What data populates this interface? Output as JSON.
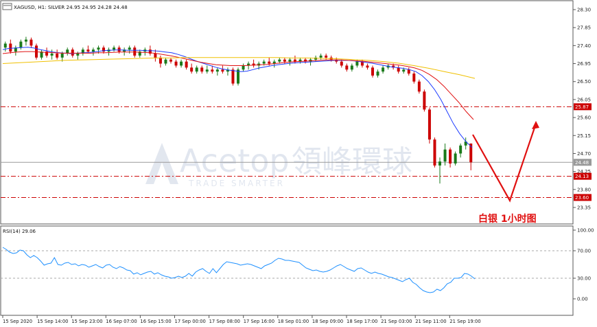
{
  "header": {
    "symbol_line": "XAGUSD, H1:  SILVER  24.95 24.95 24.28 24.48"
  },
  "annotation": {
    "text": "白银  1小时图"
  },
  "watermark": {
    "brand": "Acetop",
    "chinese": "領峰環球",
    "tagline": "TRADE SMARTER"
  },
  "colors": {
    "bull": "#1a7a1a",
    "bear": "#cc0000",
    "ma_fast": "#1e3cff",
    "ma_mid": "#e01010",
    "ma_slow": "#f0c000",
    "level_line": "#cc0000",
    "rsi_line": "#1e90ff",
    "arrow": "#e01010"
  },
  "chart_data": [
    {
      "type": "candlestick",
      "name": "XAGUSD H1",
      "yticks": [
        "28.30",
        "27.85",
        "27.40",
        "26.95",
        "26.50",
        "26.05",
        "25.60",
        "25.15",
        "24.70",
        "24.25",
        "23.80",
        "23.35"
      ],
      "ylim": [
        23.05,
        28.38
      ],
      "xticks": [
        "15 Sep 2020",
        "15 Sep 14:00",
        "15 Sep 23:00",
        "16 Sep 07:00",
        "16 Sep 15:00",
        "17 Sep 00:00",
        "17 Sep 08:00",
        "17 Sep 16:00",
        "18 Sep 01:00",
        "18 Sep 09:00",
        "18 Sep 17:00",
        "21 Sep 03:00",
        "21 Sep 11:00",
        "21 Sep 19:00"
      ],
      "price_tags": [
        {
          "label": "25.87",
          "value": 25.87,
          "style": "dash-dot",
          "color": "#cc0000"
        },
        {
          "label": "24.48",
          "value": 24.48,
          "style": "solid-light",
          "color": "#999999"
        },
        {
          "label": "24.13",
          "value": 24.13,
          "style": "dash-dot",
          "color": "#cc0000"
        },
        {
          "label": "23.60",
          "value": 23.6,
          "style": "dash-dot",
          "color": "#cc0000"
        }
      ],
      "candles": [
        [
          27.35,
          27.5,
          27.25,
          27.45
        ],
        [
          27.45,
          27.55,
          27.2,
          27.25
        ],
        [
          27.25,
          27.4,
          27.15,
          27.35
        ],
        [
          27.35,
          27.55,
          27.3,
          27.5
        ],
        [
          27.5,
          27.62,
          27.4,
          27.55
        ],
        [
          27.55,
          27.6,
          27.35,
          27.4
        ],
        [
          27.4,
          27.45,
          27.05,
          27.1
        ],
        [
          27.1,
          27.3,
          27.05,
          27.25
        ],
        [
          27.25,
          27.35,
          27.1,
          27.15
        ],
        [
          27.15,
          27.3,
          27.05,
          27.2
        ],
        [
          27.2,
          27.3,
          27.05,
          27.1
        ],
        [
          27.1,
          27.25,
          27.0,
          27.2
        ],
        [
          27.2,
          27.35,
          27.15,
          27.3
        ],
        [
          27.3,
          27.35,
          27.1,
          27.15
        ],
        [
          27.15,
          27.25,
          27.05,
          27.2
        ],
        [
          27.2,
          27.35,
          27.15,
          27.3
        ],
        [
          27.3,
          27.4,
          27.2,
          27.25
        ],
        [
          27.25,
          27.35,
          27.15,
          27.3
        ],
        [
          27.3,
          27.4,
          27.2,
          27.35
        ],
        [
          27.35,
          27.4,
          27.2,
          27.25
        ],
        [
          27.25,
          27.35,
          27.15,
          27.3
        ],
        [
          27.3,
          27.4,
          27.25,
          27.35
        ],
        [
          27.35,
          27.4,
          27.2,
          27.25
        ],
        [
          27.25,
          27.35,
          27.15,
          27.3
        ],
        [
          27.3,
          27.4,
          27.2,
          27.35
        ],
        [
          27.35,
          27.4,
          27.1,
          27.15
        ],
        [
          27.15,
          27.3,
          27.1,
          27.25
        ],
        [
          27.25,
          27.35,
          27.15,
          27.3
        ],
        [
          27.3,
          27.4,
          27.15,
          27.2
        ],
        [
          27.2,
          27.3,
          27.0,
          27.1
        ],
        [
          27.1,
          27.15,
          26.85,
          26.95
        ],
        [
          26.95,
          27.1,
          26.9,
          27.05
        ],
        [
          27.05,
          27.1,
          26.95,
          27.0
        ],
        [
          27.0,
          27.05,
          26.85,
          26.9
        ],
        [
          26.9,
          27.05,
          26.85,
          27.0
        ],
        [
          27.0,
          27.05,
          26.8,
          26.85
        ],
        [
          26.85,
          26.95,
          26.7,
          26.75
        ],
        [
          26.75,
          26.9,
          26.7,
          26.85
        ],
        [
          26.85,
          26.9,
          26.7,
          26.75
        ],
        [
          26.75,
          26.9,
          26.7,
          26.8
        ],
        [
          26.8,
          26.9,
          26.7,
          26.75
        ],
        [
          26.75,
          26.85,
          26.65,
          26.8
        ],
        [
          26.8,
          26.9,
          26.7,
          26.75
        ],
        [
          26.75,
          26.85,
          26.65,
          26.8
        ],
        [
          26.8,
          26.85,
          26.4,
          26.45
        ],
        [
          26.45,
          26.85,
          26.4,
          26.8
        ],
        [
          26.8,
          26.95,
          26.75,
          26.9
        ],
        [
          26.9,
          27.0,
          26.8,
          26.95
        ],
        [
          26.95,
          27.05,
          26.85,
          26.9
        ],
        [
          26.9,
          27.0,
          26.8,
          26.95
        ],
        [
          26.95,
          27.05,
          26.9,
          27.0
        ],
        [
          27.0,
          27.1,
          26.9,
          26.95
        ],
        [
          26.95,
          27.05,
          26.85,
          27.0
        ],
        [
          27.0,
          27.1,
          26.95,
          27.05
        ],
        [
          27.05,
          27.1,
          26.95,
          27.0
        ],
        [
          27.0,
          27.1,
          26.9,
          27.05
        ],
        [
          27.05,
          27.15,
          26.95,
          27.0
        ],
        [
          27.0,
          27.1,
          26.95,
          27.05
        ],
        [
          27.05,
          27.1,
          26.95,
          27.0
        ],
        [
          27.0,
          27.1,
          26.9,
          27.05
        ],
        [
          27.05,
          27.15,
          27.0,
          27.1
        ],
        [
          27.1,
          27.2,
          27.05,
          27.15
        ],
        [
          27.15,
          27.2,
          27.05,
          27.1
        ],
        [
          27.1,
          27.15,
          27.0,
          27.05
        ],
        [
          27.05,
          27.1,
          26.95,
          27.0
        ],
        [
          27.0,
          27.05,
          26.85,
          26.9
        ],
        [
          26.9,
          26.95,
          26.75,
          26.8
        ],
        [
          26.8,
          26.95,
          26.75,
          26.9
        ],
        [
          26.9,
          27.05,
          26.85,
          27.0
        ],
        [
          27.0,
          27.05,
          26.85,
          26.9
        ],
        [
          26.9,
          26.95,
          26.8,
          26.85
        ],
        [
          26.85,
          26.9,
          26.6,
          26.65
        ],
        [
          26.65,
          26.8,
          26.6,
          26.75
        ],
        [
          26.75,
          26.9,
          26.7,
          26.85
        ],
        [
          26.85,
          26.95,
          26.8,
          26.9
        ],
        [
          26.9,
          26.95,
          26.8,
          26.85
        ],
        [
          26.85,
          26.9,
          26.7,
          26.75
        ],
        [
          26.75,
          26.85,
          26.7,
          26.8
        ],
        [
          26.8,
          26.85,
          26.65,
          26.7
        ],
        [
          26.7,
          26.75,
          26.45,
          26.5
        ],
        [
          26.5,
          26.55,
          26.2,
          26.25
        ],
        [
          26.25,
          26.3,
          25.75,
          25.8
        ],
        [
          25.8,
          25.85,
          24.95,
          25.05
        ],
        [
          25.05,
          25.1,
          24.35,
          24.4
        ],
        [
          24.4,
          24.6,
          23.95,
          24.5
        ],
        [
          24.5,
          24.95,
          24.4,
          24.8
        ],
        [
          24.8,
          24.85,
          24.35,
          24.45
        ],
        [
          24.45,
          24.75,
          24.4,
          24.7
        ],
        [
          24.7,
          24.95,
          24.6,
          24.9
        ],
        [
          24.9,
          25.1,
          24.8,
          25.0
        ],
        [
          24.95,
          24.95,
          24.28,
          24.48
        ]
      ],
      "ma_fast_values": [
        27.3,
        27.33,
        27.34,
        27.35,
        27.36,
        27.34,
        27.3,
        27.27,
        27.24,
        27.22,
        27.21,
        27.2,
        27.21,
        27.22,
        27.23,
        27.25,
        27.27,
        27.28,
        27.29,
        27.29,
        27.28,
        27.28,
        27.28,
        27.27,
        27.27,
        27.26,
        27.24,
        27.22,
        27.18,
        27.13,
        27.07,
        27.01,
        26.96,
        26.91,
        26.86,
        26.82,
        26.79,
        26.77,
        26.75,
        26.76,
        26.8,
        26.84,
        26.87,
        26.9,
        26.92,
        26.94,
        26.96,
        26.97,
        26.98,
        26.99,
        27.0,
        27.01,
        27.02,
        27.03,
        27.03,
        27.03,
        27.02,
        27.0,
        26.98,
        26.96,
        26.93,
        26.9,
        26.87,
        26.85,
        26.83,
        26.8,
        26.75,
        26.65,
        26.5,
        26.3,
        26.05,
        25.75,
        25.45,
        25.2,
        25.0,
        24.85
      ],
      "ma_mid_values": [
        27.2,
        27.22,
        27.24,
        27.25,
        27.25,
        27.24,
        27.23,
        27.22,
        27.21,
        27.21,
        27.21,
        27.21,
        27.21,
        27.22,
        27.22,
        27.23,
        27.24,
        27.24,
        27.24,
        27.23,
        27.22,
        27.2,
        27.17,
        27.14,
        27.1,
        27.06,
        27.02,
        26.98,
        26.95,
        26.92,
        26.91,
        26.9,
        26.9,
        26.9,
        26.91,
        26.92,
        26.93,
        26.95,
        26.97,
        26.99,
        27.0,
        27.01,
        27.02,
        27.03,
        27.04,
        27.04,
        27.04,
        27.03,
        27.02,
        27.01,
        26.99,
        26.97,
        26.95,
        26.93,
        26.91,
        26.88,
        26.84,
        26.78,
        26.68,
        26.55,
        26.38,
        26.18,
        25.98,
        25.75,
        25.55
      ],
      "ma_slow_values": [
        26.95,
        26.97,
        26.99,
        27.01,
        27.03,
        27.04,
        27.05,
        27.06,
        27.07,
        27.08,
        27.09,
        27.09,
        27.1,
        27.1,
        27.1,
        27.1,
        27.1,
        27.1,
        27.1,
        27.09,
        27.09,
        27.08,
        27.07,
        27.05,
        27.03,
        27.0,
        26.96,
        26.9,
        26.83,
        26.75,
        26.67,
        26.58
      ],
      "header_text": "XAGUSD, H1:  SILVER  24.95 24.95 24.28 24.48"
    },
    {
      "type": "line",
      "name": "RSI(14)",
      "title": "RSI(14) 29.06",
      "yticks": [
        "100.00",
        "70.00",
        "30.00",
        "0.00"
      ],
      "levels": [
        70,
        30
      ],
      "ylim": [
        0,
        100
      ],
      "values": [
        75,
        72,
        68,
        66,
        67,
        71,
        70,
        64,
        60,
        63,
        60,
        55,
        49,
        51,
        52,
        60,
        50,
        49,
        52,
        53,
        50,
        51,
        48,
        50,
        49,
        46,
        48,
        50,
        47,
        45,
        49,
        50,
        46,
        44,
        47,
        45,
        42,
        41,
        36,
        38,
        35,
        37,
        39,
        40,
        36,
        38,
        35,
        33,
        32,
        30,
        31,
        33,
        31,
        33,
        37,
        33,
        39,
        42,
        44,
        40,
        37,
        44,
        38,
        44,
        50,
        54,
        53,
        52,
        51,
        49,
        50,
        51,
        50,
        48,
        46,
        44,
        48,
        50,
        52,
        56,
        59,
        58,
        56,
        56,
        55,
        54,
        53,
        49,
        45,
        43,
        41,
        42,
        40,
        39,
        40,
        42,
        45,
        48,
        50,
        47,
        44,
        42,
        40,
        44,
        45,
        42,
        39,
        37,
        39,
        37,
        36,
        34,
        32,
        31,
        29,
        27,
        25,
        28,
        30,
        24,
        21,
        16,
        12,
        10,
        9,
        10,
        14,
        12,
        16,
        22,
        24,
        30,
        30,
        31,
        37,
        36,
        33,
        29
      ]
    }
  ]
}
